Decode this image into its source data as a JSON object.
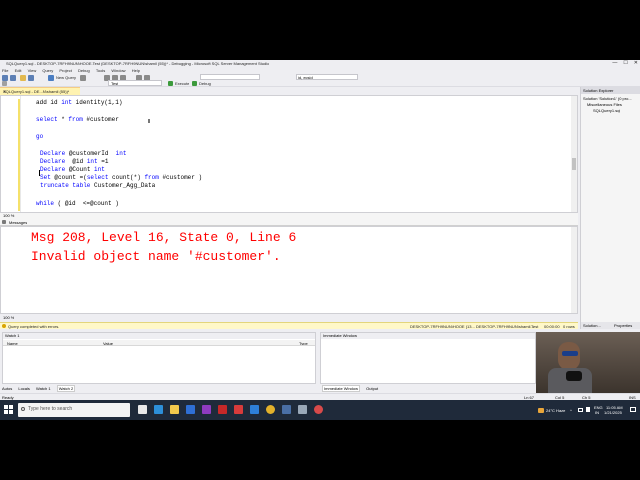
{
  "window": {
    "title": "SQLQuery1.sql - DESKTOP-7RFH9NUN\\HOOE.Test (DESKTOP-7RFH9NUN\\shamil (55))* - Debugging - Microsoft SQL Server Management Studio",
    "minimize": "—",
    "maximize": "☐",
    "close": "✕"
  },
  "menu": [
    "File",
    "Edit",
    "View",
    "Query",
    "Project",
    "Debug",
    "Tools",
    "Window",
    "Help"
  ],
  "toolbar": {
    "new_query": "New Query",
    "database": "Test",
    "execute": "Execute",
    "debug": "Debug",
    "search_field": "id, ecsid"
  },
  "doc_tab": {
    "label": "SQLQuery1.sql - DE...N\\shamil (55))*",
    "close": "✕"
  },
  "editor": {
    "lines": [
      {
        "indent": 0,
        "tokens": [
          {
            "t": "add id ",
            "k": false
          },
          {
            "t": "int",
            "k": true
          },
          {
            "t": " identity(1,1)",
            "k": false
          }
        ]
      },
      {
        "indent": 0,
        "tokens": [
          {
            "t": "select",
            "k": true
          },
          {
            "t": " * ",
            "k": false
          },
          {
            "t": "from",
            "k": true
          },
          {
            "t": " #customer",
            "k": false
          }
        ]
      },
      {
        "indent": 0,
        "tokens": [
          {
            "t": "go",
            "k": true
          }
        ]
      },
      {
        "indent": 1,
        "tokens": [
          {
            "t": "Declare",
            "k": true
          },
          {
            "t": " @customerId  ",
            "k": false
          },
          {
            "t": "int",
            "k": true
          }
        ]
      },
      {
        "indent": 1,
        "tokens": [
          {
            "t": "Declare",
            "k": true
          },
          {
            "t": "  @id ",
            "k": false
          },
          {
            "t": "int",
            "k": true
          },
          {
            "t": " =1",
            "k": false
          }
        ]
      },
      {
        "indent": 1,
        "tokens": [
          {
            "t": "Declare",
            "k": true
          },
          {
            "t": " @Count ",
            "k": false
          },
          {
            "t": "int",
            "k": true
          }
        ]
      },
      {
        "indent": 1,
        "tokens": [
          {
            "t": "Set",
            "k": true
          },
          {
            "t": " @count =(",
            "k": false
          },
          {
            "t": "select",
            "k": true
          },
          {
            "t": " count(*) ",
            "k": false
          },
          {
            "t": "from",
            "k": true
          },
          {
            "t": " #customer )",
            "k": false
          }
        ]
      },
      {
        "indent": 1,
        "tokens": [
          {
            "t": "truncate table",
            "k": true
          },
          {
            "t": " Customer_Agg_Data",
            "k": false
          }
        ]
      },
      {
        "indent": 0,
        "tokens": [
          {
            "t": "while",
            "k": true
          },
          {
            "t": " ( @id  <=@count )",
            "k": false
          }
        ]
      }
    ],
    "zoom": "100 %"
  },
  "results": {
    "tab": "Messages",
    "error_line1": "Msg 208, Level 16, State 0, Line 6",
    "error_line2": "Invalid object name '#customer'.",
    "zoom": "100 %"
  },
  "query_status": {
    "message": "Query completed with errors.",
    "server": "DESKTOP-7RFH9NUN\\HOOE (13...",
    "user": "DESKTOP-7RFH9NUN\\shamil...",
    "database": "Test",
    "time": "00:00:00",
    "rows": "0 rows"
  },
  "solution_explorer": {
    "title": "Solution Explorer",
    "items": [
      "Solution 'Solution1' (0 pro...",
      "Miscellaneous Files",
      "SQLQuery1.sql"
    ],
    "tab_solution": "Solution...",
    "tab_properties": "Properties"
  },
  "watch": {
    "title": "Watch 1",
    "columns": [
      "Name",
      "Value",
      "Type"
    ],
    "tabs": [
      "Autos",
      "Locals",
      "Watch 1",
      "Watch 2"
    ]
  },
  "immediate": {
    "title": "Immediate Window",
    "tabs": [
      "Immediate Window",
      "Output"
    ]
  },
  "statusbar": {
    "ready": "Ready",
    "ln": "Ln 67",
    "col": "Col 5",
    "ch": "Ch 5",
    "mode": "INS"
  },
  "taskbar": {
    "search_placeholder": "Type here to search",
    "weather": "24°C  Haze",
    "lang": "ENG",
    "region": "IN",
    "clock_time": "11:05 AM",
    "clock_date": "1/21/2025"
  },
  "colors": {
    "keyword": "#0000ff",
    "error": "#ff0000",
    "accent": "#68217a",
    "taskbar": "#1f2a3a"
  }
}
